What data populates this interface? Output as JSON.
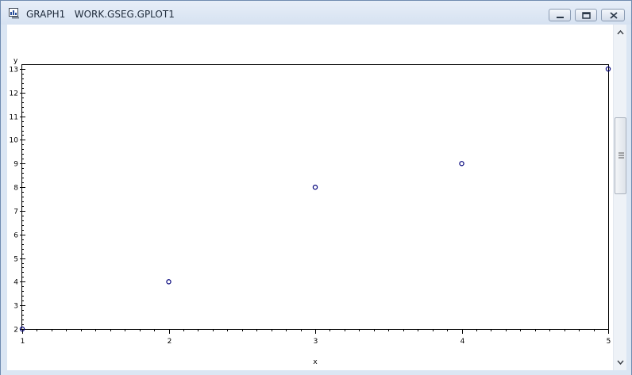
{
  "window": {
    "title": "GRAPH1   WORK.GSEG.GPLOT1",
    "icon": "graph-window-icon",
    "buttons": [
      "minimize",
      "maximize",
      "close"
    ]
  },
  "chart_data": {
    "type": "scatter",
    "title": "",
    "xlabel": "x",
    "ylabel": "y",
    "x_ticks": [
      1,
      2,
      3,
      4,
      5
    ],
    "y_ticks": [
      2,
      3,
      4,
      5,
      6,
      7,
      8,
      9,
      10,
      11,
      12,
      13
    ],
    "xlim": [
      1,
      5
    ],
    "ylim": [
      2,
      13
    ],
    "grid": false,
    "marker": "circle",
    "marker_color": "#00007a",
    "points": [
      {
        "x": 1,
        "y": 2
      },
      {
        "x": 2,
        "y": 4
      },
      {
        "x": 3,
        "y": 8
      },
      {
        "x": 4,
        "y": 9
      },
      {
        "x": 5,
        "y": 13
      }
    ]
  }
}
